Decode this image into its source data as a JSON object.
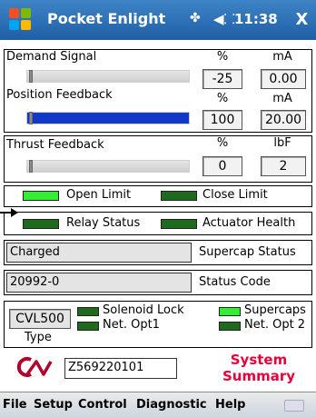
{
  "titlebar": {
    "app_title": "Pocket Enlight",
    "time": "11:38",
    "close_glyph": "X",
    "signal_icon": "signal-icon",
    "volume_icon": "speaker-icon"
  },
  "demand": {
    "label": "Demand Signal",
    "percent_header": "%",
    "ma_header": "mA",
    "percent_value": "-25",
    "ma_value": "0.00"
  },
  "position": {
    "label": "Position Feedback",
    "percent_header": "%",
    "ma_header": "mA",
    "percent_value": "100",
    "ma_value": "20.00",
    "fill_percent": 100
  },
  "thrust": {
    "label": "Thrust Feedback",
    "percent_header": "%",
    "unit_header": "lbF",
    "percent_value": "0",
    "unit_value": "2"
  },
  "limits": {
    "open_label": "Open Limit",
    "close_label": "Close Limit",
    "open_on": true,
    "close_on": false
  },
  "relay": {
    "relay_label": "Relay Status",
    "health_label": "Actuator Health",
    "relay_on": false,
    "health_on": false
  },
  "supercap": {
    "value": "Charged",
    "label": "Supercap Status"
  },
  "status": {
    "value": "20992-0",
    "label": "Status Code"
  },
  "type_panel": {
    "type_value": "CVL500",
    "type_label": "Type",
    "solenoid_label": "Solenoid Lock",
    "supercaps_label": "Supercaps",
    "netopt1_label": "Net. Opt1",
    "netopt2_label": "Net. Opt 2"
  },
  "footer": {
    "serial": "Z569220101",
    "summary_line1": "System",
    "summary_line2": "Summary",
    "accent": "#e8003a",
    "logo_icon": "enlight-logo-icon"
  },
  "menu": {
    "file": "File",
    "setup": "Setup",
    "control": "Control",
    "diagnostic": "Diagnostic",
    "help": "Help",
    "keyboard_icon": "keyboard-icon"
  },
  "colors": {
    "led_on": "#33ee33",
    "led_off": "#1e6a1e",
    "position_fill": "#1238c8",
    "titlebar": "#2b6db5"
  }
}
